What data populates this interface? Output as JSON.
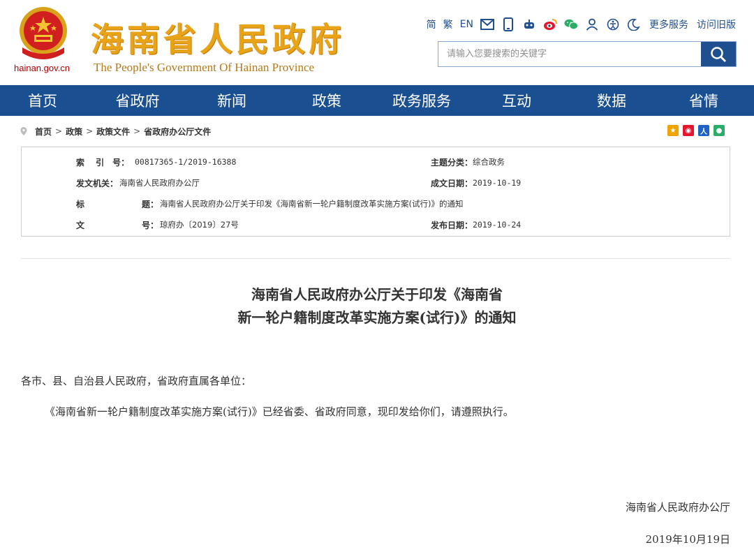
{
  "header": {
    "domain": "hainan.gov.cn",
    "title": "海南省人民政府",
    "subtitle": "The People's Government Of Hainan Province",
    "lang_simplified": "简",
    "lang_traditional": "繁",
    "lang_english": "EN",
    "more_services": "更多服务",
    "old_version": "访问旧版",
    "icons": [
      "mail-icon",
      "mobile-icon",
      "robot-icon",
      "weibo-icon",
      "wechat-icon",
      "user-icon",
      "accessibility-icon",
      "elderly-mode-icon"
    ]
  },
  "search": {
    "placeholder": "请输入您要搜索的关键字"
  },
  "nav": {
    "items": [
      {
        "label": "首页"
      },
      {
        "label": "省政府"
      },
      {
        "label": "新闻"
      },
      {
        "label": "政策"
      },
      {
        "label": "政务服务"
      },
      {
        "label": "互动"
      },
      {
        "label": "数据"
      },
      {
        "label": "省情"
      }
    ]
  },
  "breadcrumb": {
    "items": [
      "首页",
      "政策",
      "政策文件",
      "省政府办公厅文件"
    ],
    "separator": ">"
  },
  "info": {
    "index_label": "索　 引　号：",
    "index_value": "00817365-1/2019-16388",
    "topic_label": "主题分类：",
    "topic_value": "综合政务",
    "issuer_label": "发文机关：",
    "issuer_value": "海南省人民政府办公厅",
    "created_label": "成文日期：",
    "created_value": "2019-10-19",
    "title_label_1": "标",
    "title_label_2": "题：",
    "title_value": "海南省人民政府办公厅关于印发《海南省新一轮户籍制度改革实施方案(试行)》的通知",
    "docno_label_1": "文",
    "docno_label_2": "号：",
    "docno_value": "琼府办〔2019〕27号",
    "published_label": "发布日期：",
    "published_value": "2019-10-24"
  },
  "article": {
    "title_line1": "海南省人民政府办公厅关于印发《海南省",
    "title_line2": "新一轮户籍制度改革实施方案(试行)》的通知",
    "salutation": "各市、县、自治县人民政府，省政府直属各单位：",
    "paragraph": "《海南省新一轮户籍制度改革实施方案(试行)》已经省委、省政府同意，现印发给你们，请遵照执行。",
    "signer": "海南省人民政府办公厅",
    "date": "2019年10月19日"
  },
  "colors": {
    "nav_bg": "#1a4f92",
    "title_gold": "#e8a317",
    "link_blue": "#1f4f8f"
  }
}
